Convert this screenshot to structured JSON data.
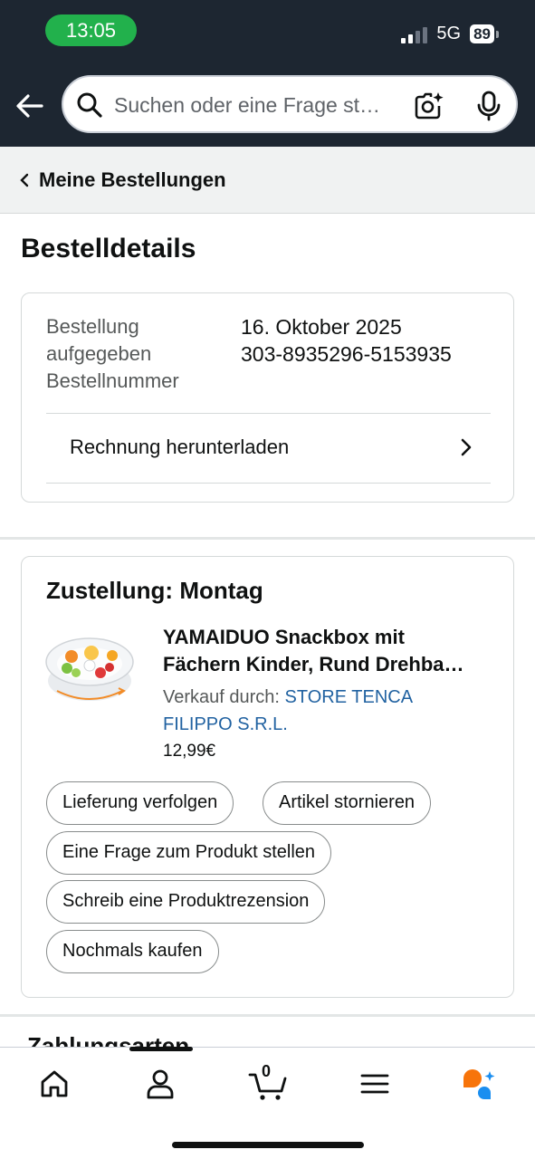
{
  "status_bar": {
    "time": "13:05",
    "network": "5G",
    "battery": "89"
  },
  "header": {
    "search_placeholder": "Suchen oder eine Frage st…"
  },
  "breadcrumb": {
    "label": "Meine Bestellungen"
  },
  "page": {
    "title": "Bestelldetails"
  },
  "order_info": {
    "placed_label_1": "Bestellung",
    "placed_label_2": "aufgegeben",
    "number_label": "Bestellnummer",
    "placed_value": "16. Oktober 2025",
    "number_value": "303-8935296-5153935",
    "invoice_label": "Rechnung herunterladen"
  },
  "delivery": {
    "title": "Zustellung: Montag",
    "product_title_line1": "YAMAIDUO Snackbox mit",
    "product_title_line2": "Fächern Kinder, Rund Drehba…",
    "sold_by_label": "Verkauf durch: ",
    "seller_name_1": "STORE TENCA",
    "seller_name_2": "FILIPPO S.R.L.",
    "price": "12,99€",
    "actions": {
      "track": "Lieferung verfolgen",
      "cancel": "Artikel stornieren",
      "question": "Eine Frage zum Produkt stellen",
      "review": "Schreib eine Produktrezension",
      "buy_again": "Nochmals kaufen"
    }
  },
  "payment_section": {
    "title": "Zahlungsarten"
  },
  "bottom_nav": {
    "cart_count": "0",
    "icons": [
      "home-icon",
      "account-icon",
      "cart-icon",
      "menu-icon",
      "rufus-icon"
    ]
  },
  "colors": {
    "header_bg": "#1d2631",
    "link": "#2162a1",
    "time_pill": "#22b14c",
    "rufus_orange": "#f7740a",
    "rufus_blue": "#1a8ef0"
  }
}
